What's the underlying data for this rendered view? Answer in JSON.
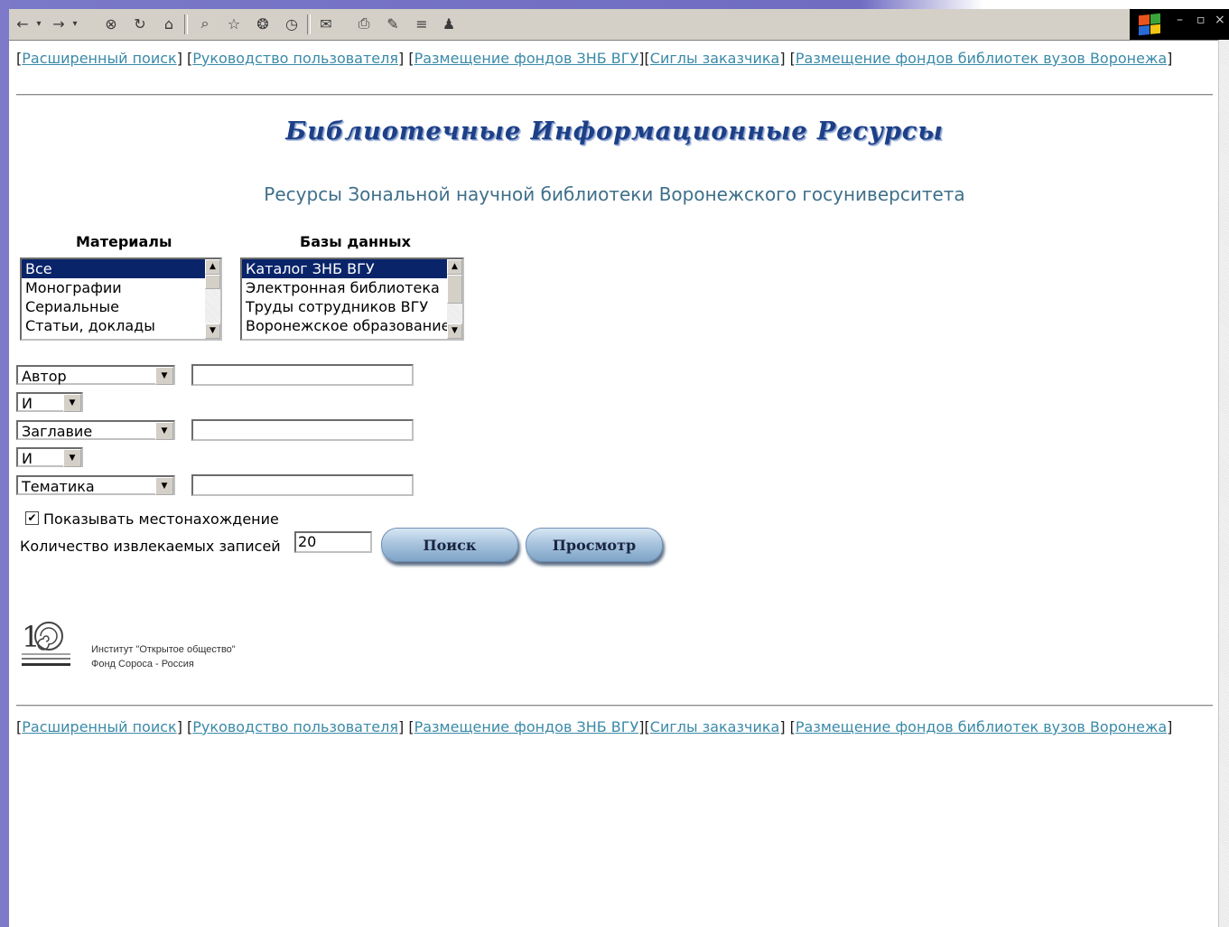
{
  "toolbar": {
    "icons": [
      "back-icon",
      "back-dropdown-icon",
      "forward-icon",
      "forward-dropdown-icon",
      "stop-icon",
      "refresh-icon",
      "home-icon",
      "search-icon",
      "favorites-icon",
      "media-icon",
      "history-icon",
      "mail-icon",
      "print-icon",
      "edit-icon",
      "discuss-icon",
      "messenger-icon"
    ],
    "window_controls": [
      "–",
      "▫",
      "×"
    ]
  },
  "nav": {
    "links": [
      "Расширенный поиск",
      "Руководство пользователя",
      "Размещение фондов ЗНБ ВГУ",
      "Сиглы заказчика",
      "Размещение фондов библиотек вузов Воронежа"
    ]
  },
  "header": {
    "title": "Библиотечные Информационные Ресурсы",
    "subtitle": "Ресурсы Зональной научной библиотеки Воронежского госуниверситета"
  },
  "materials": {
    "label": "Материалы",
    "options": [
      "Все",
      "Монографии",
      "Сериальные",
      "Статьи, доклады"
    ],
    "selected": "Все"
  },
  "databases": {
    "label": "Базы данных",
    "options": [
      "Каталог ЗНБ ВГУ",
      "Электронная библиотека",
      "Труды сотрудников ВГУ",
      "Воронежское образование"
    ],
    "selected": "Каталог ЗНБ ВГУ"
  },
  "search": {
    "field1": "Автор",
    "op1": "И",
    "field2": "Заглавие",
    "op2": "И",
    "field3": "Тематика",
    "value1": "",
    "value2": "",
    "value3": ""
  },
  "options": {
    "show_location_label": "Показывать местонахождение",
    "show_location_checked": "✔",
    "count_label": "Количество извлекаемых записей",
    "count_value": "20"
  },
  "buttons": {
    "search": "Поиск",
    "browse": "Просмотр"
  },
  "footer": {
    "org_line1": "Институт \"Открытое общество\"",
    "org_line2": "Фонд Сороса - Россия"
  }
}
